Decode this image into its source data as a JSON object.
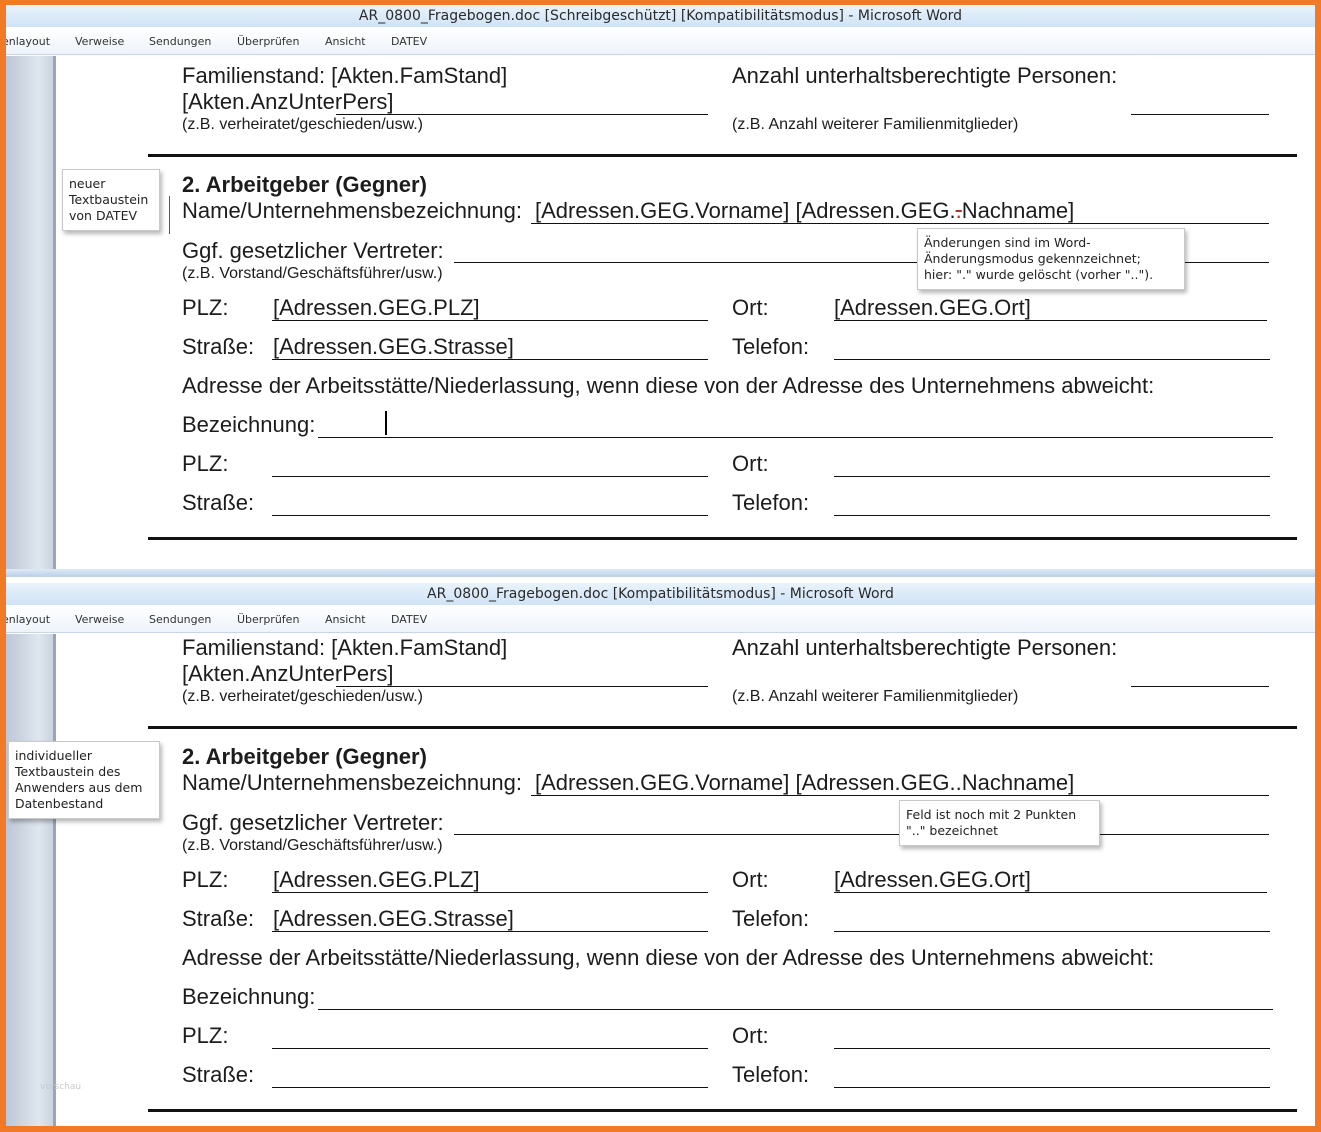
{
  "windows": [
    {
      "title": "AR_0800_Fragebogen.doc [Schreibgeschützt] [Kompatibilitätsmodus]  -  Microsoft Word",
      "tabs": [
        "enlayout",
        "Verweise",
        "Sendungen",
        "Überprüfen",
        "Ansicht",
        "DATEV"
      ],
      "note_left": [
        "neuer",
        "Textbaustein",
        "von DATEV"
      ],
      "note_right": [
        "Änderungen sind im Word-",
        "Änderungsmodus gekennzeichnet;",
        "hier: \".\" wurde gelöscht (vorher \"..\")."
      ],
      "name_value_a": "[Adressen.GEG.Vorname] [Adressen.GEG.",
      "name_value_deleted": ".",
      "name_value_b": "Nachname]"
    },
    {
      "title": "AR_0800_Fragebogen.doc [Kompatibilitätsmodus]  -  Microsoft Word",
      "tabs": [
        "enlayout",
        "Verweise",
        "Sendungen",
        "Überprüfen",
        "Ansicht",
        "DATEV"
      ],
      "note_left": [
        "individueller",
        "Textbaustein des",
        "Anwenders aus dem",
        "Datenbestand"
      ],
      "note_right": [
        "Feld ist noch mit 2 Punkten",
        "\"..\" bezeichnet"
      ],
      "name_value": "[Adressen.GEG.Vorname] [Adressen.GEG..Nachname]",
      "faint_text": "vorschau"
    }
  ],
  "form": {
    "familienstand_label": "Familienstand: [Akten.FamStand]",
    "anz_unter_pers": "[Akten.AnzUnterPers]",
    "familienstand_hint": "(z.B. verheiratet/geschieden/usw.)",
    "anzahl_label": "Anzahl unterhaltsberechtigte Personen:",
    "anzahl_hint": "(z.B. Anzahl weiterer Familienmitglieder)",
    "section_title": "2. Arbeitgeber (Gegner)",
    "name_label": "Name/Unternehmensbezeichnung:",
    "vertreter_label": "Ggf. gesetzlicher Vertreter:",
    "vertreter_hint": "(z.B. Vorstand/Geschäftsführer/usw.)",
    "plz_label": "PLZ:",
    "plz_value": "[Adressen.GEG.PLZ]",
    "ort_label": "Ort:",
    "ort_value": "[Adressen.GEG.Ort]",
    "strasse_label": "Straße:",
    "strasse_value": "[Adressen.GEG.Strasse]",
    "telefon_label": "Telefon:",
    "adresse_hint": "Adresse der Arbeitsstätte/Niederlassung, wenn diese von der Adresse des Unternehmens abweicht:",
    "bezeichnung_label": "Bezeichnung:"
  }
}
